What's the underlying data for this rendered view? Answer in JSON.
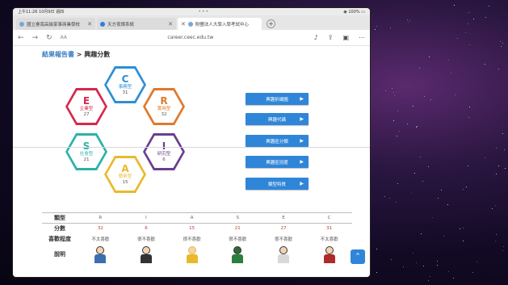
{
  "statusbar": {
    "time": "上午11:26",
    "date": "10月9日 週四",
    "dots": "•••",
    "battery": "100%"
  },
  "tabs": [
    {
      "title": "國立臺南高級家事商業學校",
      "active": false
    },
    {
      "title": "天方夜譚系統",
      "active": false
    },
    {
      "title": "財團法人大學入學考試中心",
      "active": true
    }
  ],
  "addressbar": {
    "reader": "AA",
    "url": "career.ceec.edu.tw"
  },
  "breadcrumb": {
    "link": "結果報告書",
    "separator": ">",
    "current": "興趣分數"
  },
  "hexagons": [
    {
      "letter": "C",
      "name": "事務型",
      "score": "31",
      "color": "#2d8fd6"
    },
    {
      "letter": "E",
      "name": "企業型",
      "score": "27",
      "color": "#d6284e"
    },
    {
      "letter": "R",
      "name": "實用型",
      "score": "32",
      "color": "#e0782a"
    },
    {
      "letter": "S",
      "name": "社會型",
      "score": "21",
      "color": "#2bb2a8"
    },
    {
      "letter": "I",
      "name": "研究型",
      "score": "6",
      "color": "#6b3e8f"
    },
    {
      "letter": "A",
      "name": "藝術型",
      "score": "15",
      "color": "#e9b92d"
    }
  ],
  "buttons": [
    "興趣折線圖",
    "興趣代碼",
    "興趣區分類",
    "興趣區別度",
    "類型特質"
  ],
  "table": {
    "row_labels": {
      "type": "類型",
      "score": "分數",
      "preference": "喜歡程度",
      "description": "說明"
    },
    "types": [
      "R",
      "I",
      "A",
      "S",
      "E",
      "C"
    ],
    "scores": [
      "32",
      "6",
      "15",
      "21",
      "27",
      "31"
    ],
    "preferences": [
      "不太喜歡",
      "很不喜歡",
      "很不喜歡",
      "很不喜歡",
      "很不喜歡",
      "不太喜歡"
    ]
  },
  "colors": {
    "accent": "#2f86d8",
    "score_red": "#c0392b"
  }
}
